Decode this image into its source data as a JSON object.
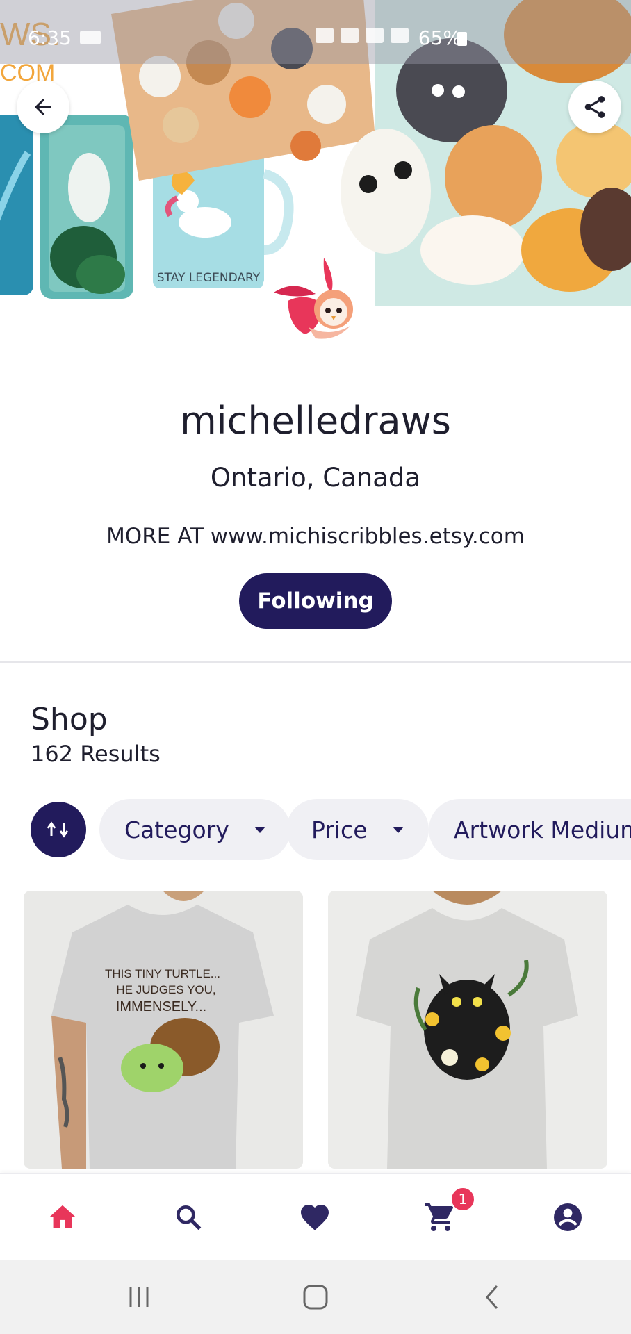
{
  "status_bar": {
    "time": "6:35",
    "battery": "65%"
  },
  "banner": {
    "back_icon": "arrow-left-icon",
    "share_icon": "share-icon",
    "mug_text": "STAY LEGENDARY",
    "overlay_text_top": "WS.",
    "overlay_text_bottom": "COM"
  },
  "profile": {
    "name": "michelledraws",
    "location": "Ontario, Canada",
    "bio": "MORE AT www.michiscribbles.etsy.com",
    "follow_label": "Following"
  },
  "shop": {
    "title": "Shop",
    "results": "162 Results",
    "sort_icon": "sort-arrows-icon",
    "filters": [
      {
        "label": "Category"
      },
      {
        "label": "Price"
      },
      {
        "label": "Artwork Medium"
      }
    ],
    "products": [
      {
        "shirt_text_1": "THIS TINY TURTLE...",
        "shirt_text_2": "HE JUDGES YOU,",
        "shirt_text_3": "IMMENSELY..."
      },
      {
        "shirt_text_1": ""
      }
    ]
  },
  "bottom_nav": {
    "items": [
      {
        "icon": "home-icon",
        "active": true
      },
      {
        "icon": "search-icon",
        "active": false
      },
      {
        "icon": "heart-icon",
        "active": false
      },
      {
        "icon": "cart-icon",
        "active": false
      },
      {
        "icon": "account-icon",
        "active": false
      }
    ],
    "cart_badge": "1"
  },
  "colors": {
    "brand_navy": "#221b5c",
    "active_pink": "#e8365a",
    "chip_bg": "#f0f0f4"
  }
}
